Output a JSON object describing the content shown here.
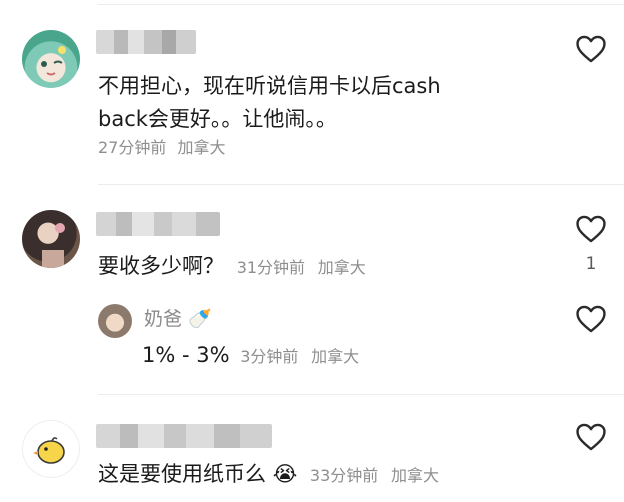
{
  "comments": [
    {
      "text_line1": "不用担心，现在听说信用卡以后cash",
      "text_line2": "back会更好。。让他闹。。",
      "time": "27分钟前",
      "location": "加拿大",
      "avatar_icon": "anime-girl-avatar"
    },
    {
      "text": "要收多少啊？",
      "time": "31分钟前",
      "location": "加拿大",
      "likes": "1",
      "avatar_icon": "dark-haired-girl-avatar",
      "reply": {
        "name": "奶爸",
        "name_emoji": "🍼",
        "text": "1% - 3%",
        "time": "3分钟前",
        "location": "加拿大",
        "avatar_icon": "child-avatar"
      }
    },
    {
      "text": "这是要使用纸币么",
      "emoji": "😭",
      "time": "33分钟前",
      "location": "加拿大",
      "avatar_icon": "yellow-chick-avatar"
    }
  ],
  "colors": {
    "meta": "#8e8e8e",
    "divider": "#ececec",
    "heart_stroke": "#2b2b2b"
  }
}
